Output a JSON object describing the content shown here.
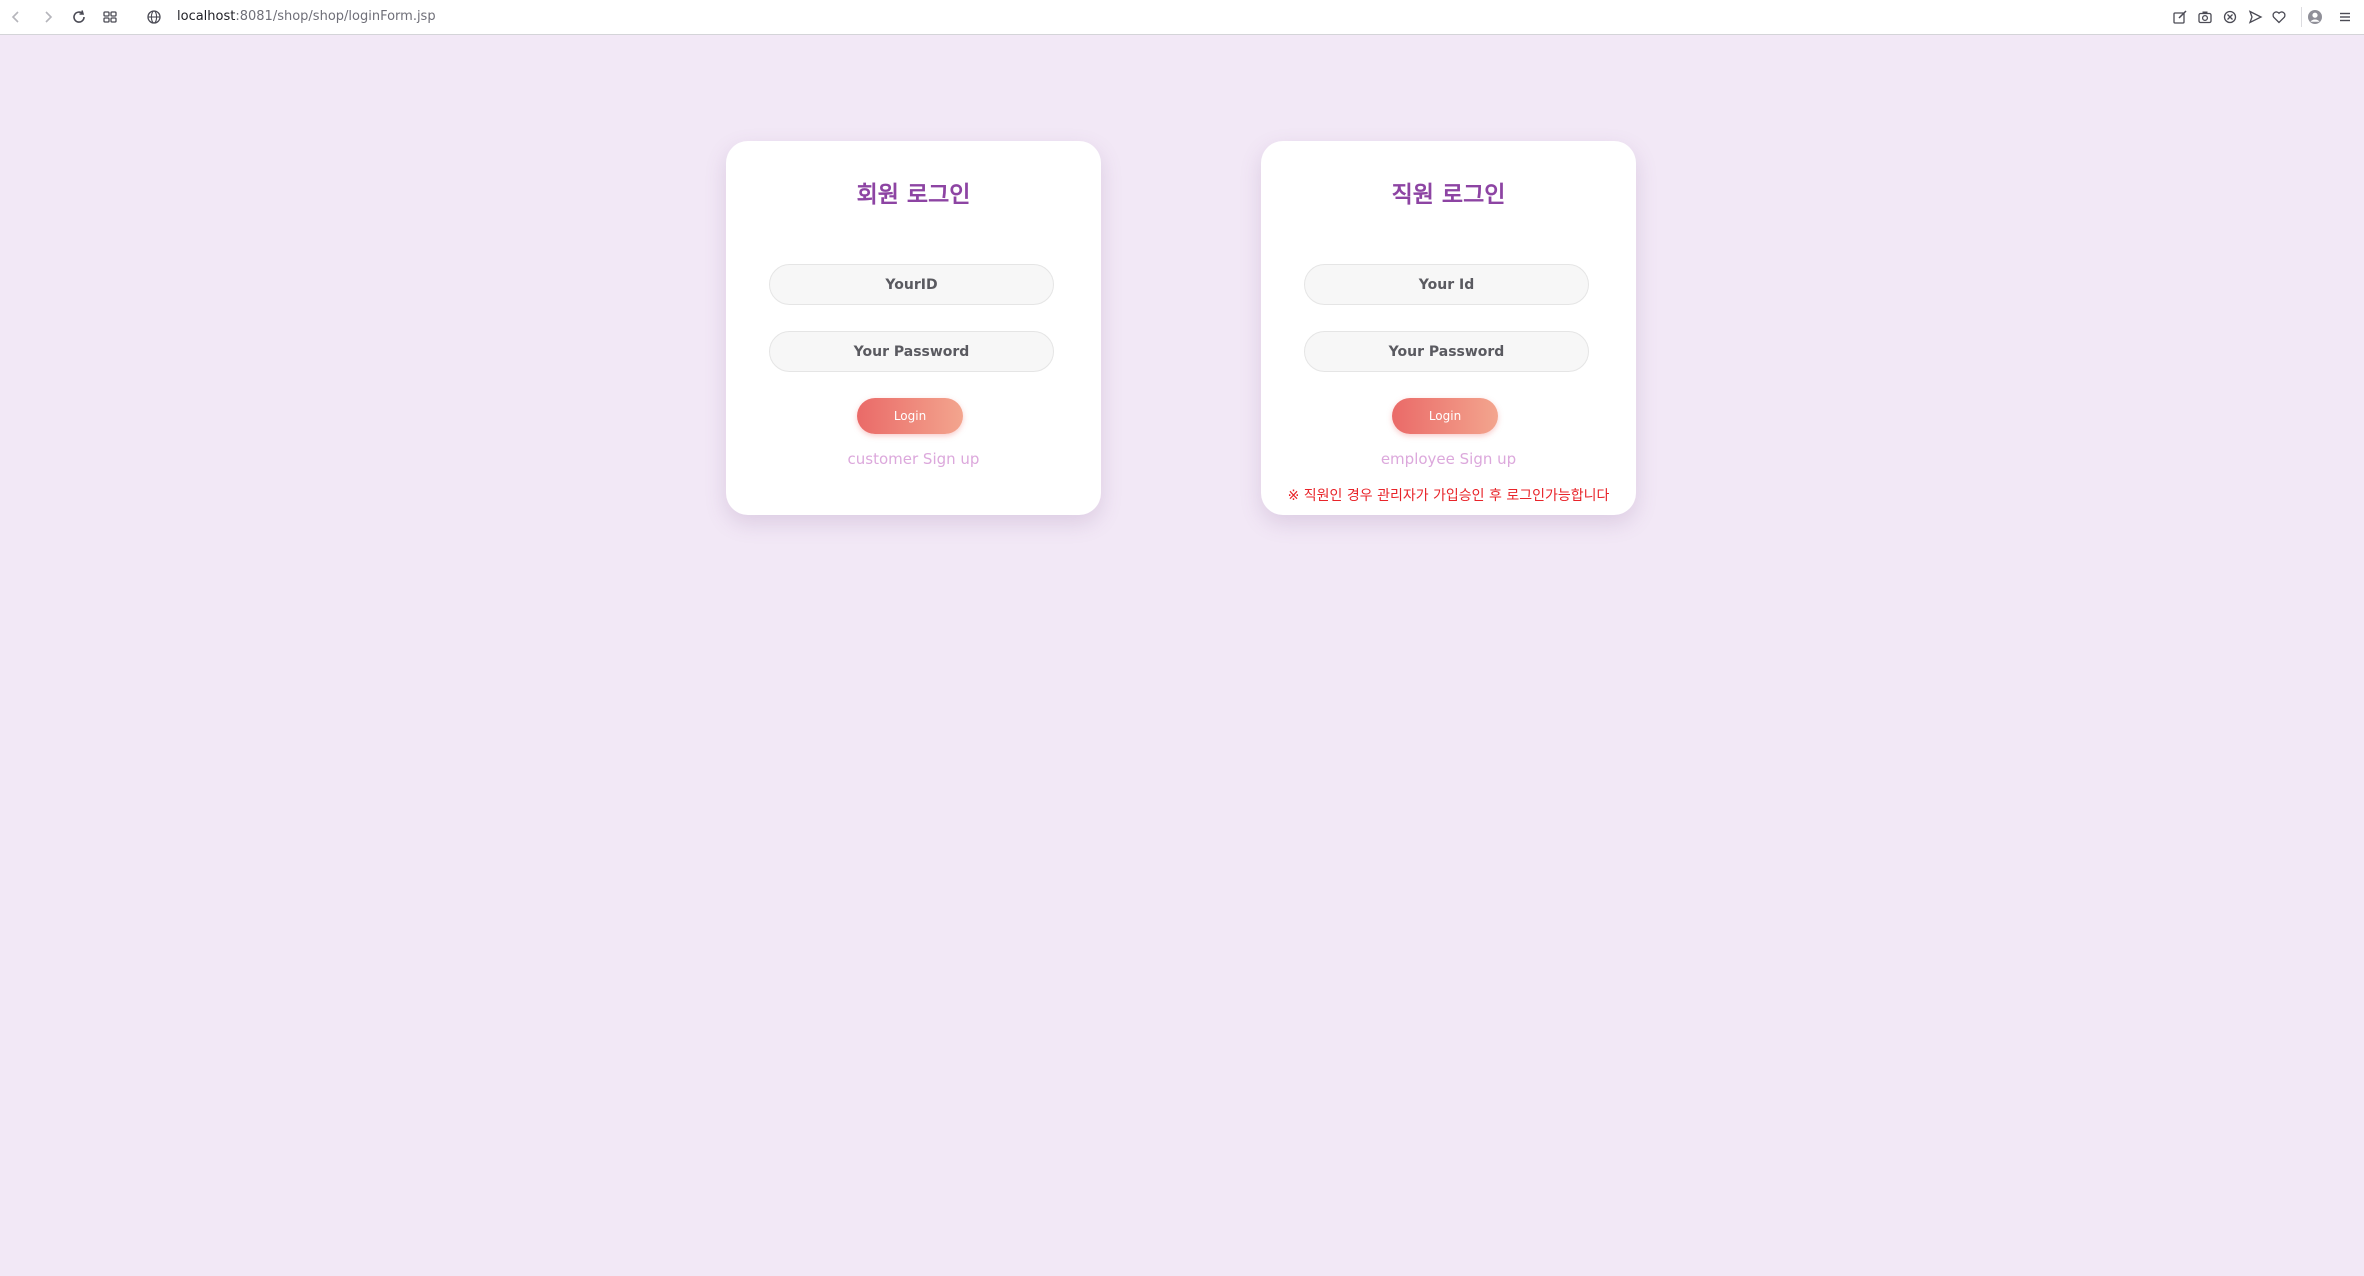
{
  "browser": {
    "url_host": "localhost",
    "url_rest": ":8081/shop/shop/loginForm.jsp",
    "icons": [
      "back-icon",
      "forward-icon",
      "reload-icon",
      "tabs-grid-icon",
      "globe-icon",
      "edit-icon",
      "camera-icon",
      "shield-icon",
      "send-icon",
      "heart-icon",
      "profile-icon",
      "menu-icon"
    ]
  },
  "customer_login": {
    "title": "회원 로그인",
    "id_placeholder": "YourID",
    "password_placeholder": "Your Password",
    "login_label": "Login",
    "signup_label": "customer Sign up"
  },
  "employee_login": {
    "title": "직원 로그인",
    "id_placeholder": "Your Id",
    "password_placeholder": "Your Password",
    "login_label": "Login",
    "signup_label": "employee Sign up",
    "notice": "※ 직원인 경우 관리자가 가입승인 후 로그인가능합니다"
  },
  "colors": {
    "background": "#f2e8f6",
    "title": "#8d44a3",
    "button_start": "#ea6a68",
    "button_end": "#f3a58e",
    "link": "#dca8dc",
    "notice": "#e8242a"
  }
}
